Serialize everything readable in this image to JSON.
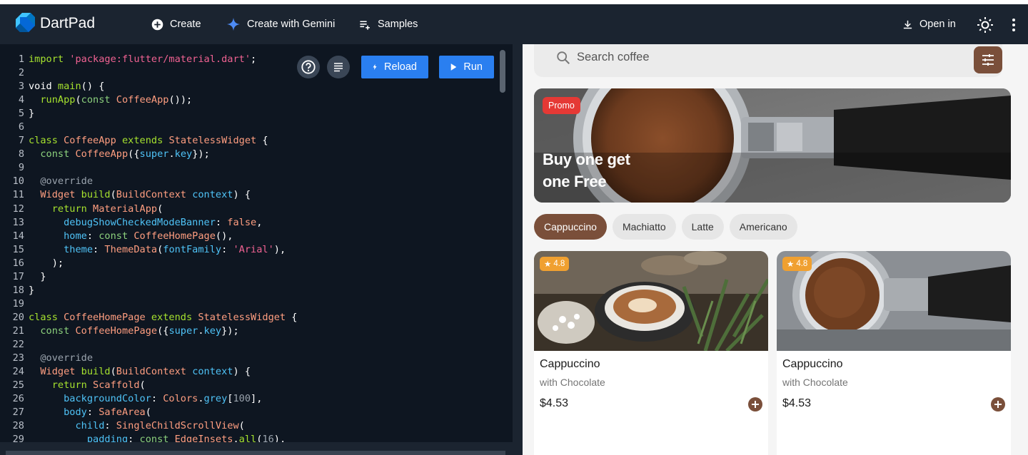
{
  "header": {
    "title": "DartPad",
    "create_label": "Create",
    "gemini_label": "Create with Gemini",
    "samples_label": "Samples",
    "open_in_label": "Open in"
  },
  "editor": {
    "reload_label": "Reload",
    "run_label": "Run",
    "lines": [
      [
        [
          "kw",
          "import"
        ],
        [
          "ct",
          " "
        ],
        [
          "str",
          "'package:flutter/material.dart'"
        ],
        [
          "ct",
          ";"
        ]
      ],
      [],
      [
        [
          "ct",
          "void "
        ],
        [
          "kw",
          "main"
        ],
        [
          "ct",
          "() {"
        ]
      ],
      [
        [
          "ct",
          "  "
        ],
        [
          "kw",
          "runApp"
        ],
        [
          "ct",
          "("
        ],
        [
          "kw2",
          "const"
        ],
        [
          "ct",
          " "
        ],
        [
          "cls",
          "CoffeeApp"
        ],
        [
          "ct",
          "());"
        ]
      ],
      [
        [
          "ct",
          "}"
        ]
      ],
      [],
      [
        [
          "kw",
          "class"
        ],
        [
          "ct",
          " "
        ],
        [
          "cls",
          "CoffeeApp"
        ],
        [
          "ct",
          " "
        ],
        [
          "kw",
          "extends"
        ],
        [
          "ct",
          " "
        ],
        [
          "cls",
          "StatelessWidget"
        ],
        [
          "ct",
          " {"
        ]
      ],
      [
        [
          "ct",
          "  "
        ],
        [
          "kw2",
          "const"
        ],
        [
          "ct",
          " "
        ],
        [
          "cls",
          "CoffeeApp"
        ],
        [
          "ct",
          "({"
        ],
        [
          "prop",
          "super"
        ],
        [
          "ct",
          "."
        ],
        [
          "prop",
          "key"
        ],
        [
          "ct",
          "});"
        ]
      ],
      [],
      [
        [
          "ct",
          "  "
        ],
        [
          "com",
          "@override"
        ]
      ],
      [
        [
          "ct",
          "  "
        ],
        [
          "cls",
          "Widget"
        ],
        [
          "ct",
          " "
        ],
        [
          "kw",
          "build"
        ],
        [
          "ct",
          "("
        ],
        [
          "cls",
          "BuildContext"
        ],
        [
          "ct",
          " "
        ],
        [
          "prop",
          "context"
        ],
        [
          "ct",
          ") {"
        ]
      ],
      [
        [
          "ct",
          "    "
        ],
        [
          "kw",
          "return"
        ],
        [
          "ct",
          " "
        ],
        [
          "cls",
          "MaterialApp"
        ],
        [
          "ct",
          "("
        ]
      ],
      [
        [
          "ct",
          "      "
        ],
        [
          "prop",
          "debugShowCheckedModeBanner"
        ],
        [
          "ct",
          ": "
        ],
        [
          "cls",
          "false"
        ],
        [
          "ct",
          ","
        ]
      ],
      [
        [
          "ct",
          "      "
        ],
        [
          "prop",
          "home"
        ],
        [
          "ct",
          ": "
        ],
        [
          "kw2",
          "const"
        ],
        [
          "ct",
          " "
        ],
        [
          "cls",
          "CoffeeHomePage"
        ],
        [
          "ct",
          "(),"
        ]
      ],
      [
        [
          "ct",
          "      "
        ],
        [
          "prop",
          "theme"
        ],
        [
          "ct",
          ": "
        ],
        [
          "cls",
          "ThemeData"
        ],
        [
          "ct",
          "("
        ],
        [
          "prop",
          "fontFamily"
        ],
        [
          "ct",
          ": "
        ],
        [
          "str",
          "'Arial'"
        ],
        [
          "ct",
          "),"
        ]
      ],
      [
        [
          "ct",
          "    );"
        ]
      ],
      [
        [
          "ct",
          "  }"
        ]
      ],
      [
        [
          "ct",
          "}"
        ]
      ],
      [],
      [
        [
          "kw",
          "class"
        ],
        [
          "ct",
          " "
        ],
        [
          "cls",
          "CoffeeHomePage"
        ],
        [
          "ct",
          " "
        ],
        [
          "kw",
          "extends"
        ],
        [
          "ct",
          " "
        ],
        [
          "cls",
          "StatelessWidget"
        ],
        [
          "ct",
          " {"
        ]
      ],
      [
        [
          "ct",
          "  "
        ],
        [
          "kw2",
          "const"
        ],
        [
          "ct",
          " "
        ],
        [
          "cls",
          "CoffeeHomePage"
        ],
        [
          "ct",
          "({"
        ],
        [
          "prop",
          "super"
        ],
        [
          "ct",
          "."
        ],
        [
          "prop",
          "key"
        ],
        [
          "ct",
          "});"
        ]
      ],
      [],
      [
        [
          "ct",
          "  "
        ],
        [
          "com",
          "@override"
        ]
      ],
      [
        [
          "ct",
          "  "
        ],
        [
          "cls",
          "Widget"
        ],
        [
          "ct",
          " "
        ],
        [
          "kw",
          "build"
        ],
        [
          "ct",
          "("
        ],
        [
          "cls",
          "BuildContext"
        ],
        [
          "ct",
          " "
        ],
        [
          "prop",
          "context"
        ],
        [
          "ct",
          ") {"
        ]
      ],
      [
        [
          "ct",
          "    "
        ],
        [
          "kw",
          "return"
        ],
        [
          "ct",
          " "
        ],
        [
          "cls",
          "Scaffold"
        ],
        [
          "ct",
          "("
        ]
      ],
      [
        [
          "ct",
          "      "
        ],
        [
          "prop",
          "backgroundColor"
        ],
        [
          "ct",
          ": "
        ],
        [
          "cls",
          "Colors"
        ],
        [
          "ct",
          "."
        ],
        [
          "prop",
          "grey"
        ],
        [
          "ct",
          "["
        ],
        [
          "num",
          "100"
        ],
        [
          "ct",
          "],"
        ]
      ],
      [
        [
          "ct",
          "      "
        ],
        [
          "prop",
          "body"
        ],
        [
          "ct",
          ": "
        ],
        [
          "cls",
          "SafeArea"
        ],
        [
          "ct",
          "("
        ]
      ],
      [
        [
          "ct",
          "        "
        ],
        [
          "prop",
          "child"
        ],
        [
          "ct",
          ": "
        ],
        [
          "cls",
          "SingleChildScrollView"
        ],
        [
          "ct",
          "("
        ]
      ],
      [
        [
          "ct",
          "          "
        ],
        [
          "prop",
          "padding"
        ],
        [
          "ct",
          ": "
        ],
        [
          "kw2",
          "const"
        ],
        [
          "ct",
          " "
        ],
        [
          "cls",
          "EdgeInsets"
        ],
        [
          "ct",
          "."
        ],
        [
          "kw",
          "all"
        ],
        [
          "ct",
          "("
        ],
        [
          "num",
          "16"
        ],
        [
          "ct",
          "),"
        ]
      ]
    ]
  },
  "preview": {
    "search_placeholder": "Search coffee",
    "promo_label": "Promo",
    "banner_line1": "Buy one get",
    "banner_line2": "one Free",
    "chips": [
      "Cappuccino",
      "Machiatto",
      "Latte",
      "Americano"
    ],
    "cards": [
      {
        "rating": "4.8",
        "name": "Cappuccino",
        "sub": "with Chocolate",
        "price": "$4.53"
      },
      {
        "rating": "4.8",
        "name": "Cappuccino",
        "sub": "with Chocolate",
        "price": "$4.53"
      }
    ]
  },
  "colors": {
    "header_bg": "#1b2430",
    "editor_bg": "#0e1621",
    "run_button": "#2a7ff0",
    "accent_brown": "#7a4f3a",
    "promo_red": "#e53935",
    "rating_orange": "#f0a030"
  }
}
